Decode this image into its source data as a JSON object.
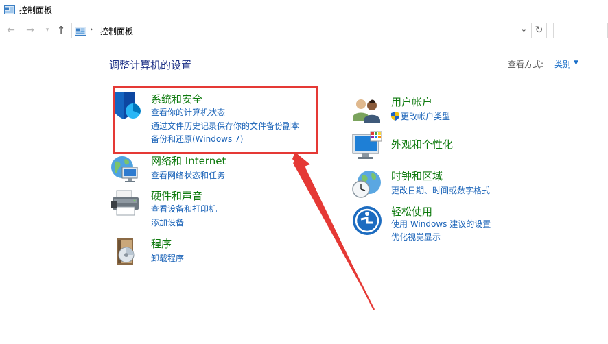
{
  "window": {
    "title": "控制面板"
  },
  "address": {
    "path": "控制面板",
    "separator": "›"
  },
  "heading": "调整计算机的设置",
  "view_by": {
    "label": "查看方式:",
    "value": "类别"
  },
  "categories": {
    "system_security": {
      "title": "系统和安全",
      "icon": "shield-icon",
      "links": [
        "查看你的计算机状态",
        "通过文件历史记录保存你的文件备份副本",
        "备份和还原(Windows 7)"
      ]
    },
    "network": {
      "title": "网络和 Internet",
      "icon": "network-globe-icon",
      "links": [
        "查看网络状态和任务"
      ]
    },
    "hardware": {
      "title": "硬件和声音",
      "icon": "printer-icon",
      "links": [
        "查看设备和打印机",
        "添加设备"
      ]
    },
    "programs": {
      "title": "程序",
      "icon": "programs-disc-icon",
      "links": [
        "卸载程序"
      ]
    },
    "user_accounts": {
      "title": "用户帐户",
      "icon": "users-icon",
      "links": [
        "更改帐户类型"
      ]
    },
    "appearance": {
      "title": "外观和个性化",
      "icon": "monitor-palette-icon",
      "links": []
    },
    "clock_region": {
      "title": "时钟和区域",
      "icon": "clock-globe-icon",
      "links": [
        "更改日期、时间或数字格式"
      ]
    },
    "ease_of_access": {
      "title": "轻松使用",
      "icon": "ease-of-access-icon",
      "links": [
        "使用 Windows 建议的设置",
        "优化视觉显示"
      ]
    }
  },
  "colors": {
    "category_title": "#0e7a0e",
    "link": "#1a63b8",
    "heading": "#1e3287",
    "annotation": "#e53935"
  }
}
